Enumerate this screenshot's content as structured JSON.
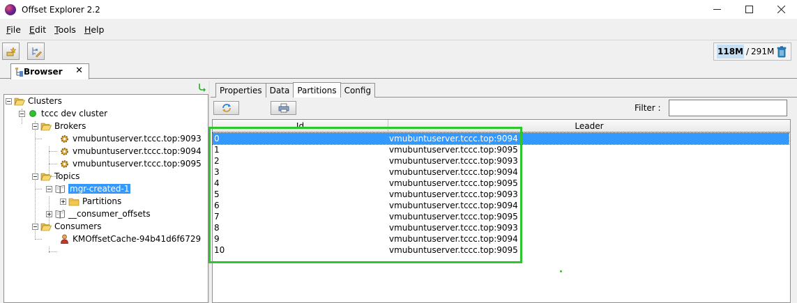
{
  "window": {
    "title": "Offset Explorer  2.2"
  },
  "menu": [
    {
      "key": "F",
      "rest": "ile"
    },
    {
      "key": "E",
      "rest": "dit"
    },
    {
      "key": "T",
      "rest": "ools"
    },
    {
      "key": "H",
      "rest": "elp"
    }
  ],
  "memory": {
    "used": "118M",
    "sep": "/",
    "total": "291M"
  },
  "main_tab": {
    "label": "Browser",
    "close": "✕"
  },
  "tree": {
    "clusters": "Clusters",
    "cluster": "tccc dev cluster",
    "brokers": "Brokers",
    "broker_list": [
      "vmubuntuserver.tccc.top:9093",
      "vmubuntuserver.tccc.top:9094",
      "vmubuntuserver.tccc.top:9095"
    ],
    "topics": "Topics",
    "topic_selected": "mgr-created-1",
    "partitions": "Partitions",
    "topic_other": "__consumer_offsets",
    "consumers": "Consumers",
    "consumer": "KMOffsetCache-94b41d6f6729"
  },
  "subtabs": [
    "Properties",
    "Data",
    "Partitions",
    "Config"
  ],
  "active_subtab": "Partitions",
  "filter": {
    "label": "Filter :",
    "value": ""
  },
  "grid": {
    "columns": [
      "Id",
      "Leader"
    ],
    "rows": [
      {
        "id": "0",
        "leader": "vmubuntuserver.tccc.top:9094"
      },
      {
        "id": "1",
        "leader": "vmubuntuserver.tccc.top:9095"
      },
      {
        "id": "2",
        "leader": "vmubuntuserver.tccc.top:9093"
      },
      {
        "id": "3",
        "leader": "vmubuntuserver.tccc.top:9094"
      },
      {
        "id": "4",
        "leader": "vmubuntuserver.tccc.top:9095"
      },
      {
        "id": "5",
        "leader": "vmubuntuserver.tccc.top:9093"
      },
      {
        "id": "6",
        "leader": "vmubuntuserver.tccc.top:9094"
      },
      {
        "id": "7",
        "leader": "vmubuntuserver.tccc.top:9095"
      },
      {
        "id": "8",
        "leader": "vmubuntuserver.tccc.top:9093"
      },
      {
        "id": "9",
        "leader": "vmubuntuserver.tccc.top:9094"
      },
      {
        "id": "10",
        "leader": "vmubuntuserver.tccc.top:9095"
      }
    ],
    "selected_row": 0
  },
  "colors": {
    "selection": "#3399ff",
    "highlight_box": "#2ec52e",
    "cluster_status": "#2fbf2f",
    "folder": "#f3c64e"
  }
}
